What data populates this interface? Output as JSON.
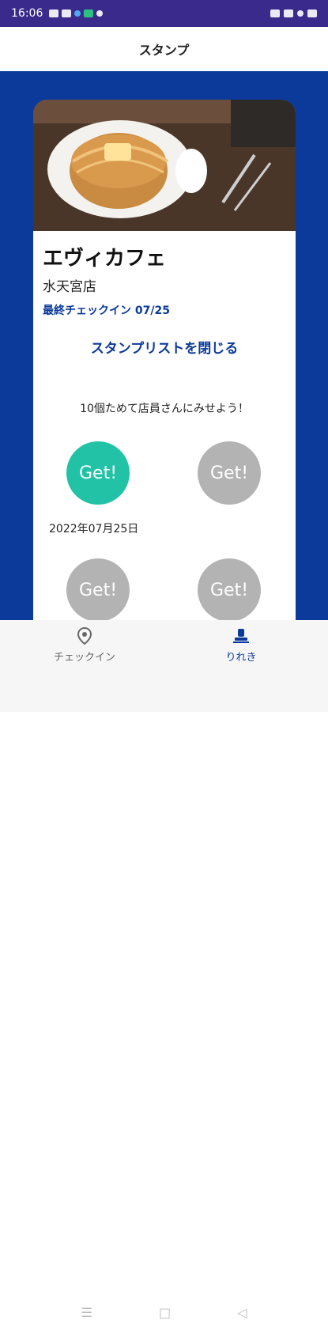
{
  "status_bar": {
    "time": "16:06",
    "icons": [
      "signal-icon",
      "wifi-icon",
      "notification-icon",
      "battery-icon",
      "bluetooth-icon"
    ]
  },
  "header": {
    "title": "スタンプ"
  },
  "shop": {
    "name": "エヴィカフェ",
    "branch": "水天宮店",
    "last_checkin": "最終チェックイン 07/25"
  },
  "actions": {
    "close_list": "スタンプリストを閉じる"
  },
  "instructions": "10個ためて店員さんにみせよう！",
  "stamps": {
    "items": [
      {
        "label": "Get!",
        "status": "collected"
      },
      {
        "label": "Get!",
        "status": "empty"
      },
      {
        "label": "Get!",
        "status": "empty"
      },
      {
        "label": "Get!",
        "status": "empty"
      }
    ],
    "collected_date": "2022年07月25日"
  },
  "bottom_nav": {
    "items": [
      {
        "label": "チェックイン",
        "icon": "location-pin-icon",
        "active": false
      },
      {
        "label": "りれき",
        "icon": "stamp-icon",
        "active": true
      }
    ]
  },
  "system_nav": {
    "icons": [
      "menu-icon",
      "home-icon",
      "back-icon"
    ]
  },
  "colors": {
    "primary": "#0b3a9a",
    "stamp_collected": "#21c2a6",
    "stamp_empty": "#b3b3b3",
    "status_bar": "#3a2a8c"
  }
}
